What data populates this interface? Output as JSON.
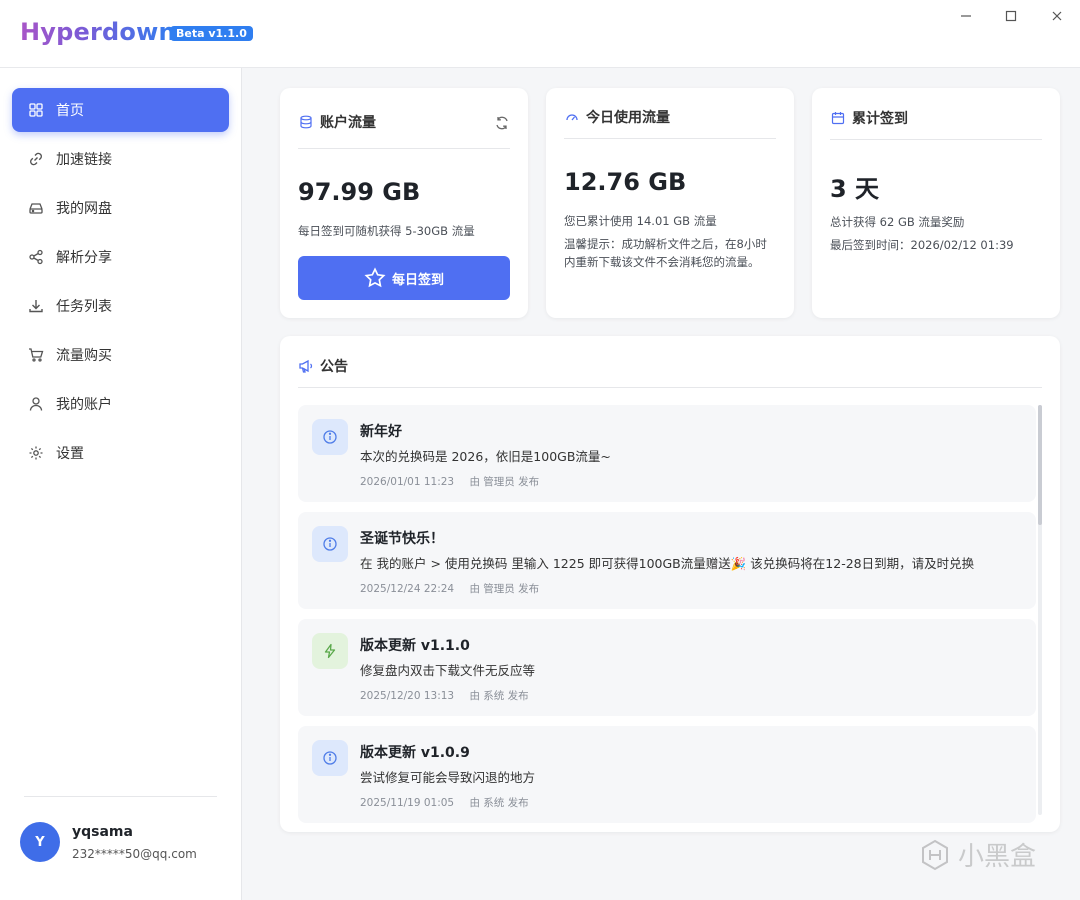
{
  "app": {
    "title": "Hyperdown",
    "badge": "Beta v1.1.0"
  },
  "window_controls": [
    "minimize-icon",
    "maximize-icon",
    "close-icon"
  ],
  "sidebar": {
    "items": [
      {
        "label": "首页",
        "icon": "grid-icon",
        "active": true
      },
      {
        "label": "加速链接",
        "icon": "link-icon"
      },
      {
        "label": "我的网盘",
        "icon": "drive-icon"
      },
      {
        "label": "解析分享",
        "icon": "share-icon"
      },
      {
        "label": "任务列表",
        "icon": "download-icon"
      },
      {
        "label": "流量购买",
        "icon": "cart-icon"
      },
      {
        "label": "我的账户",
        "icon": "user-icon"
      },
      {
        "label": "设置",
        "icon": "gear-icon"
      }
    ],
    "user": {
      "initial": "Y",
      "name": "yqsama",
      "email": "232*****50@qq.com"
    }
  },
  "cards": {
    "account": {
      "title": "账户流量",
      "value": "97.99 GB",
      "desc": "每日签到可随机获得 5-30GB 流量",
      "button": "每日签到"
    },
    "today": {
      "title": "今日使用流量",
      "value": "12.76 GB",
      "desc": "您已累计使用 14.01 GB 流量",
      "tip_line1": "温馨提示：成功解析文件之后，在8小时",
      "tip_line2": "内重新下载该文件不会消耗您的流量。"
    },
    "checkin": {
      "title": "累计签到",
      "value": "3 天",
      "desc": "总计获得 62 GB 流量奖励",
      "last": "最后签到时间：2026/02/12 01:39"
    }
  },
  "announcements": {
    "title": "公告",
    "items": [
      {
        "type": "info",
        "title": "新年好",
        "body": "本次的兑换码是 2026，依旧是100GB流量~",
        "date": "2026/01/01 11:23",
        "by": "由 管理员 发布"
      },
      {
        "type": "info",
        "title": "圣诞节快乐！",
        "body": "在 我的账户 > 使用兑换码 里输入 1225 即可获得100GB流量赠送🎉 该兑换码将在12-28日到期，请及时兑换",
        "date": "2025/12/24 22:24",
        "by": "由 管理员 发布"
      },
      {
        "type": "update",
        "title": "版本更新 v1.1.0",
        "body": "修复盘内双击下载文件无反应等",
        "date": "2025/12/20 13:13",
        "by": "由 系统 发布"
      },
      {
        "type": "info",
        "title": "版本更新 v1.0.9",
        "body": "尝试修复可能会导致闪退的地方",
        "date": "2025/11/19 01:05",
        "by": "由 系统 发布"
      }
    ]
  },
  "watermark": "小黑盒"
}
